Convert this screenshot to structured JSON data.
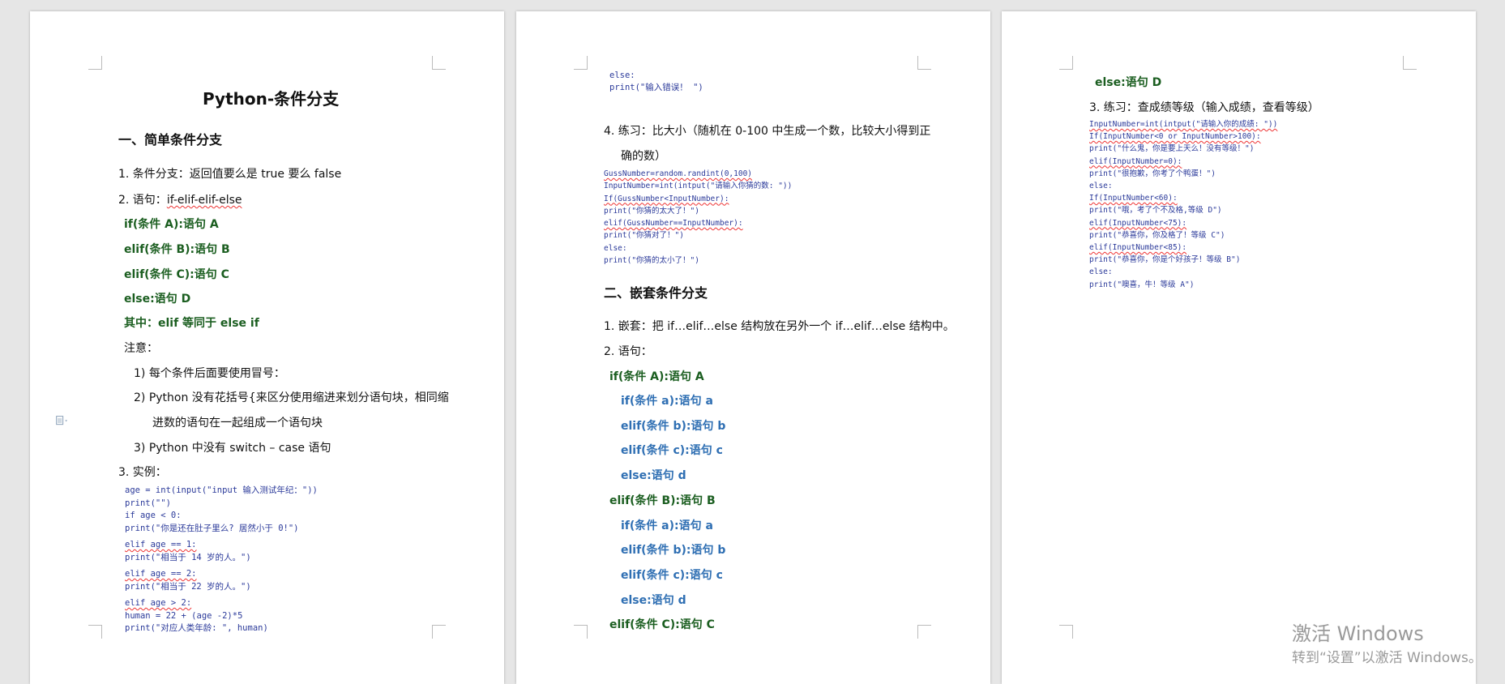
{
  "page1": {
    "title": "Python-条件分支",
    "section1": "一、简单条件分支",
    "item1": "1.  条件分支：返回值要么是 true 要么 false",
    "item2_pre": "2.  语句：",
    "item2_code": "if-elif-elif-else",
    "if_a": "if(条件 A):语句 A",
    "elif_b": "elif(条件 B):语句 B",
    "elif_c": "elif(条件 C):语句 C",
    "else_d": "else:语句 D",
    "note_elif": "其中：elif 等同于 else if",
    "note": "注意：",
    "n1": "1)   每个条件后面要使用冒号：",
    "n2a": "2)   Python 没有花括号{来区分使用缩进来划分语句块，相同缩",
    "n2b": "进数的语句在一起组成一个语句块",
    "n3": "3)   Python 中没有 switch – case 语句",
    "item3": "3.  实例：",
    "code": [
      "age = int(input(\"input 输入测试年纪：\"))",
      "print(\"\")",
      "if age < 0:",
      "    print(\"你是还在肚子里么? 居然小于 0!\")",
      "elif age == 1:",
      "    print(\"相当于 14 岁的人。\")",
      "elif age == 2:",
      "    print(\"相当于 22 岁的人。\")",
      "elif age > 2:",
      "    human = 22 + (age -2)*5",
      "    print(\"对应人类年龄: \", human)"
    ]
  },
  "page2": {
    "code_top": [
      "else:",
      "    print(\"输入错误！ \")"
    ],
    "item4a": "4.  练习：比大小（随机在 0-100 中生成一个数，比较大小得到正",
    "item4b": "确的数）",
    "code": [
      "GussNumber=random.randint(0,100)",
      "InputNumber=int(intput(\"请输入你猜的数: \"))",
      "If(GussNumber<InputNumber):",
      "    print(\"你猜的太大了！\")",
      "elif(GussNumber==InputNumber):",
      "    print(\"你猜对了！\")",
      "else:",
      "    print(\"你猜的太小了！\")"
    ],
    "section2": "二、嵌套条件分支",
    "item1": "1.  嵌套：把  if…elif…else  结构放在另外一个  if…elif…else  结构中。",
    "item2": "2.  语句：",
    "lines": [
      {
        "text": "if(条件 A):语句 A",
        "cls": "g"
      },
      {
        "text": "if(条件 a):语句 a",
        "cls": "b"
      },
      {
        "text": "elif(条件 b):语句 b",
        "cls": "b"
      },
      {
        "text": "elif(条件 c):语句 c",
        "cls": "b"
      },
      {
        "text": "else:语句 d",
        "cls": "b"
      },
      {
        "text": "elif(条件 B):语句 B",
        "cls": "g"
      },
      {
        "text": "if(条件 a):语句 a",
        "cls": "b"
      },
      {
        "text": "elif(条件 b):语句 b",
        "cls": "b"
      },
      {
        "text": "elif(条件 c):语句 c",
        "cls": "b"
      },
      {
        "text": "else:语句 d",
        "cls": "b"
      },
      {
        "text": "elif(条件 C):语句 C",
        "cls": "g"
      }
    ]
  },
  "page3": {
    "else_d": "else:语句 D",
    "item3": "3.  练习：查成绩等级（输入成绩，查看等级）",
    "code": [
      "InputNumber=int(intput(\"请输入你的成绩: \"))",
      "If(InputNumber<0 or InputNumber>100):",
      "    print(\"什么鬼，你是要上天么！没有等级！\")",
      "elif(InputNumber=0):",
      "    print(\"很抱歉，你考了个鸭蛋！\")",
      "else:",
      "    If(InputNumber<60):",
      "        print(\"哦，考了个不及格,等级 D\")",
      "    elif(InputNumber<75):",
      "        print(\"恭喜你，你及格了！等级 C\")",
      "    elif(InputNumber<85):",
      "        print(\"恭喜你，你是个好孩子！等级 B\")",
      "    else:",
      "        print(\"噢喜，牛！等级 A\")"
    ]
  },
  "watermark": {
    "line1": "激活 Windows",
    "line2": "转到“设置”以激活 Windows。"
  }
}
